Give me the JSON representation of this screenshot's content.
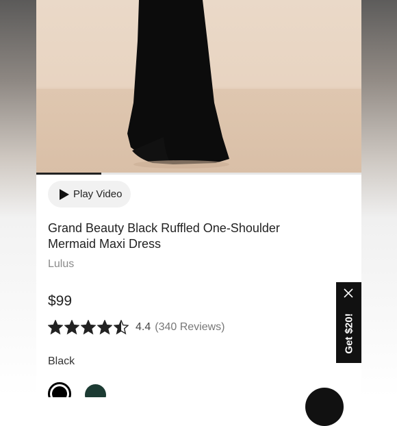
{
  "media": {
    "play_video_label": "Play Video",
    "icon": "play-icon",
    "video_progress": 0.2
  },
  "product": {
    "title_line1": "Grand Beauty Black Ruffled One-Shoulder",
    "title_line2": "Mermaid Maxi Dress",
    "brand": "Lulus",
    "price": "$99",
    "rating": {
      "value": "4.4",
      "stars_filled": 4.4,
      "stars_total": 5,
      "reviews_label": "(340 Reviews)"
    },
    "color": {
      "selected_label": "Black",
      "swatches": [
        {
          "name": "Black",
          "hex": "#000000",
          "selected": true
        },
        {
          "name": "Green",
          "hex": "#1c3b33",
          "selected": false
        }
      ]
    }
  },
  "promo": {
    "label": "Get $20!",
    "close_icon": "close-icon"
  },
  "colors": {
    "text_primary": "#222222",
    "text_muted": "#8a8a8a",
    "star": "#222222",
    "promo_bg": "#111111"
  }
}
